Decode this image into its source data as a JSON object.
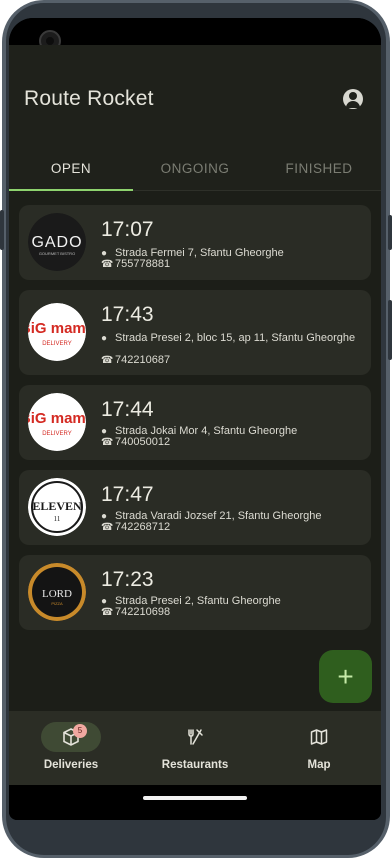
{
  "app": {
    "title": "Route Rocket"
  },
  "tabs": [
    {
      "label": "OPEN",
      "active": true
    },
    {
      "label": "ONGOING",
      "active": false
    },
    {
      "label": "FINISHED",
      "active": false
    }
  ],
  "orders": [
    {
      "time": "17:07",
      "address": "Strada Fermei 7, Sfantu Gheorghe",
      "phone": "755778881",
      "logo": {
        "name": "GADO",
        "sub": "GOURMET BISTRO",
        "icon": "gado-logo"
      }
    },
    {
      "time": "17:43",
      "address": "Strada Presei 2, bloc 15, ap 11, Sfantu Gheorghe",
      "phone": "742210687",
      "logo": {
        "name": "BiG mama",
        "sub": "DELIVERY",
        "icon": "big-mama-logo"
      }
    },
    {
      "time": "17:44",
      "address": "Strada Jokai Mor 4, Sfantu Gheorghe",
      "phone": "740050012",
      "logo": {
        "name": "BiG mama",
        "sub": "DELIVERY",
        "icon": "big-mama-logo"
      }
    },
    {
      "time": "17:47",
      "address": "Strada Varadi Jozsef 21, Sfantu Gheorghe",
      "phone": "742268712",
      "logo": {
        "name": "ELEVEN",
        "sub": "11",
        "icon": "eleven-logo"
      }
    },
    {
      "time": "17:23",
      "address": "Strada Presei 2, Sfantu Gheorghe",
      "phone": "742210698",
      "logo": {
        "name": "LORD",
        "sub": "PIZZA",
        "icon": "lord-logo"
      }
    }
  ],
  "fab": {
    "icon": "plus-icon",
    "label": "+"
  },
  "bottom_nav": [
    {
      "label": "Deliveries",
      "icon": "package-icon",
      "active": true,
      "badge": "5"
    },
    {
      "label": "Restaurants",
      "icon": "fork-knife-icon",
      "active": false
    },
    {
      "label": "Map",
      "icon": "map-icon",
      "active": false
    }
  ],
  "colors": {
    "background": "#1c1e18",
    "card": "#2a2c25",
    "accent": "#8ed36e",
    "fab": "#2f5e1e",
    "badge": "#f0a8a0"
  }
}
